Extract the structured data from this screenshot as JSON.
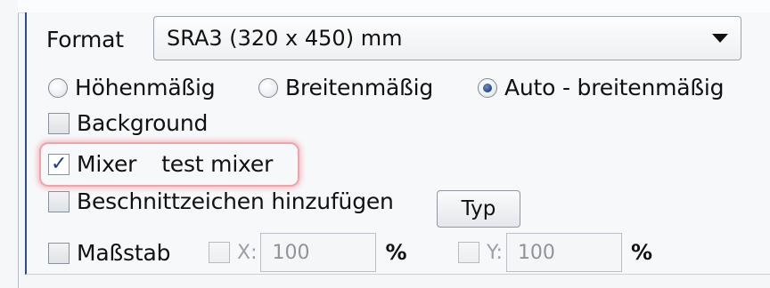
{
  "format": {
    "label": "Format",
    "selected": "SRA3 (320 x 450) mm"
  },
  "orientation": {
    "options": [
      "Höhenmäßig",
      "Breitenmäßig",
      "Auto - breitenmäßig"
    ],
    "selected": "Auto - breitenmäßig"
  },
  "background": {
    "label": "Background",
    "checked": false
  },
  "mixer": {
    "label": "Mixer",
    "value": "test mixer",
    "checked": true
  },
  "crop_marks": {
    "label": "Beschnittzeichen hinzufügen",
    "checked": false
  },
  "type_button": {
    "label": "Typ"
  },
  "scale": {
    "label": "Maßstab",
    "checked": false,
    "x": {
      "label": "X:",
      "value": "100",
      "unit": "%"
    },
    "y": {
      "label": "Y:",
      "value": "100",
      "unit": "%"
    }
  },
  "colors": {
    "accent": "#2d4e8c",
    "highlight": "#f0a3a8"
  }
}
